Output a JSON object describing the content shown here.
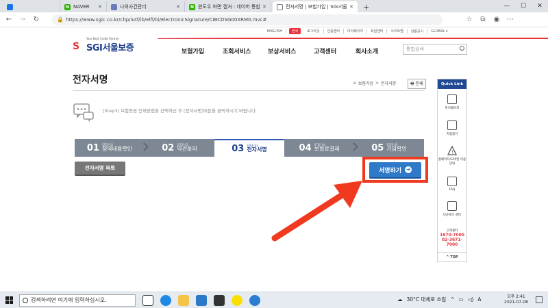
{
  "browser": {
    "tabs": [
      {
        "title": "NAVER",
        "fav": "N",
        "fav_color": "#2db400"
      },
      {
        "title": "나의사건관리",
        "fav": "",
        "fav_color": "#6a7bb8"
      },
      {
        "title": "윈도우 화면 캡처 : 네이버 통합검",
        "fav": "N",
        "fav_color": "#2db400"
      },
      {
        "title": "전자서명 | 보험가입 | SGI서울보",
        "fav": "",
        "fav_color": "#ffffff"
      }
    ],
    "url": "https://www.sgic.co.kr/chp/iutf/ib/elfi/bi/ElectronicSignature/CIBCDSG00XRM0.mvc#",
    "window_controls": [
      "—",
      "☐",
      "✕"
    ]
  },
  "site": {
    "utility": [
      "ENGLISH",
      "한국",
      "로그아웃",
      "인증센터",
      "마이페이지",
      "회원센터",
      "사이트맵",
      "상품공시",
      "GLOBAL ▾"
    ],
    "logo_tagline": "Your Best Credit Partner",
    "logo_text": "SGI서울보증",
    "gnb": [
      "보험가입",
      "조회서비스",
      "보상서비스",
      "고객센터",
      "회사소개"
    ],
    "search_placeholder": "통합검색"
  },
  "page": {
    "title": "전자서명",
    "breadcrumb": [
      "⌂",
      "보험가입",
      ">",
      "전자서명"
    ],
    "print_label": "🖶 인쇄",
    "step_desc": "[Step3] 보험증권 인쇄방법을 선택하신 후 [전자서명]버튼을 클릭하시기 바랍니다.",
    "steps": [
      {
        "num": "01",
        "small": "STEP 01",
        "name": "청약내용확인",
        "active": false
      },
      {
        "num": "02",
        "small": "STEP 02",
        "name": "약관동의",
        "active": false
      },
      {
        "num": "03",
        "small": "STEP 03",
        "name": "전자서명",
        "active": true
      },
      {
        "num": "04",
        "small": "STEP 04",
        "name": "보험료결제",
        "active": false
      },
      {
        "num": "05",
        "small": "STEP 05",
        "name": "가입확인",
        "active": false
      }
    ],
    "list_button": "전자서명 목록",
    "sign_button": "서명하기"
  },
  "quick_link": {
    "title": "Quick Link",
    "items": [
      "마이페이지",
      "지점찾기",
      "홈페이지/모바일 이용안내",
      "FAQ",
      "다운로드 센터"
    ],
    "center_label": "고객센터",
    "phones": [
      "1670-7000",
      "02-3671-7000"
    ],
    "top_label": "TOP"
  },
  "taskbar": {
    "search_placeholder": "검색하려면 여기에 입력하십시오.",
    "weather": "30°C 대체로 흐림",
    "lang": "A",
    "time": "오후 2:41",
    "date": "2021-07-08"
  },
  "colors": {
    "brand_red": "#e8323c",
    "brand_blue": "#1f4a93",
    "sign_blue": "#2f79c9",
    "highlight": "#f03a1f"
  }
}
